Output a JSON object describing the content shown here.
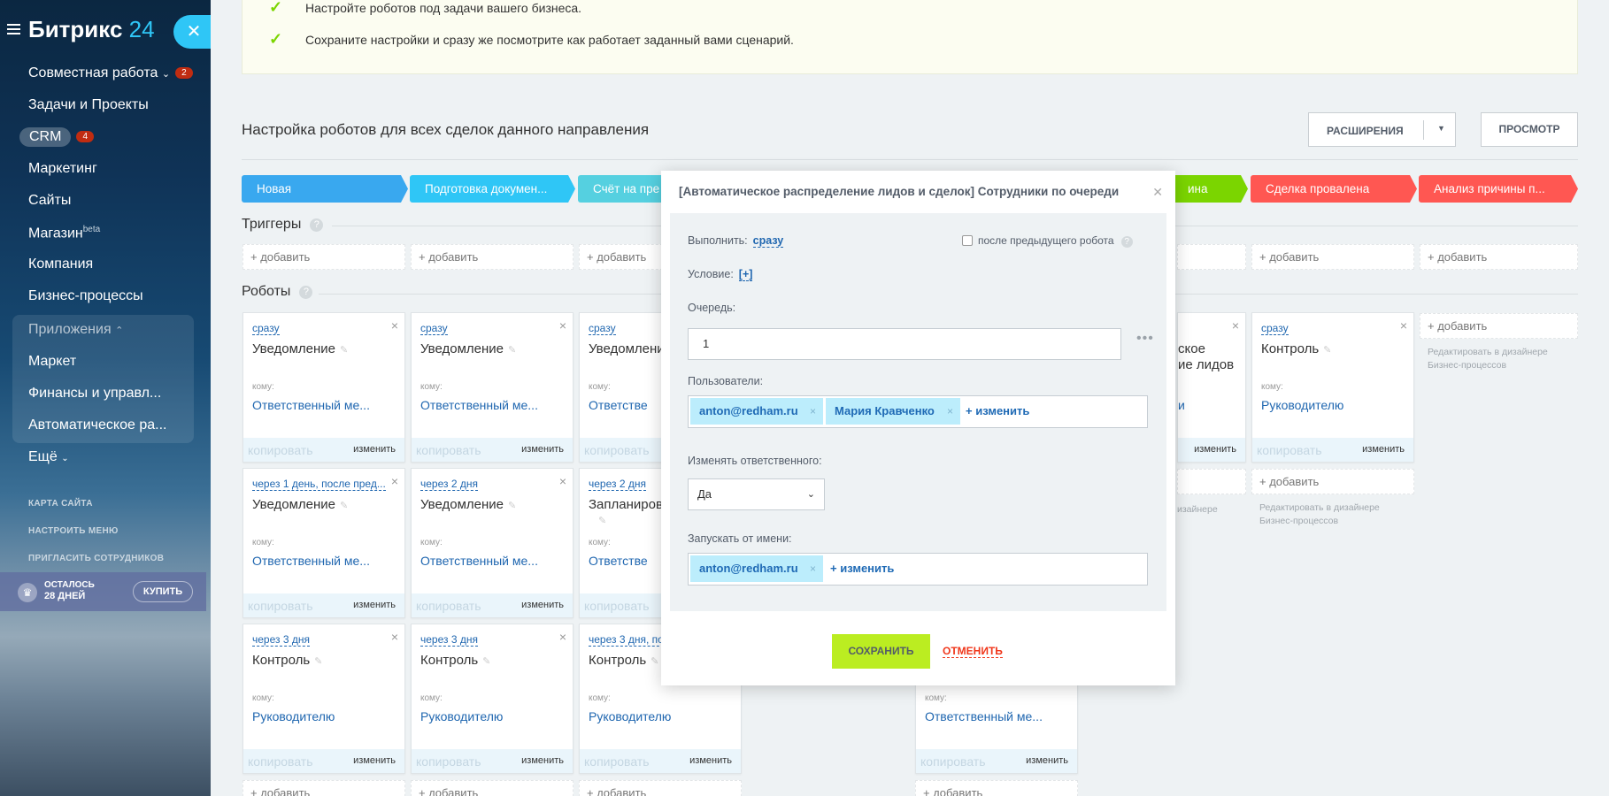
{
  "sidebar": {
    "logo_text": "Битрикс",
    "logo_num": "24",
    "menu": [
      {
        "label": "Совместная работа",
        "badge": "2"
      },
      {
        "label": "Задачи и Проекты"
      },
      {
        "label": "CRM",
        "badge": "4"
      },
      {
        "label": "Маркетинг"
      },
      {
        "label": "Сайты"
      },
      {
        "label": "Магазин",
        "sup": "beta"
      },
      {
        "label": "Компания"
      },
      {
        "label": "Бизнес-процессы"
      },
      {
        "label": "Приложения"
      },
      {
        "label": "Маркет"
      },
      {
        "label": "Финансы и управл..."
      },
      {
        "label": "Автоматическое ра..."
      },
      {
        "label": "Ещё"
      }
    ],
    "links": [
      "КАРТА САЙТА",
      "НАСТРОИТЬ МЕНЮ",
      "ПРИГЛАСИТЬ СОТРУДНИКОВ"
    ],
    "trial": {
      "line1": "ОСТАЛОСЬ",
      "line2": "28 ДНЕЙ",
      "buy": "КУПИТЬ"
    }
  },
  "info": {
    "line1": "Настройте роботов под задачи вашего бизнеса.",
    "line2": "Сохраните настройки и сразу же посмотрите как работает заданный вами сценарий."
  },
  "header": {
    "title": "Настройка роботов для всех сделок данного направления",
    "extensions_label": "РАСШИРЕНИЯ",
    "preview_label": "ПРОСМОТР"
  },
  "stages": [
    {
      "label": "Новая",
      "color": "#39a8ef"
    },
    {
      "label": "Подготовка докумен...",
      "color": "#2fc6f6"
    },
    {
      "label": "Счёт на пре",
      "color": "#55d0e0"
    },
    {
      "label": "ина",
      "color": "#7bd500"
    },
    {
      "label": "Сделка провалена",
      "color": "#ff5752"
    },
    {
      "label": "Анализ причины п...",
      "color": "#ff5752"
    }
  ],
  "triggers": {
    "label": "Триггеры",
    "add": "+ добавить"
  },
  "robots_label": "Роботы",
  "card_common": {
    "to": "кому:",
    "copy": "копировать",
    "edit": "изменить",
    "close": "×",
    "add": "+ добавить"
  },
  "cards": [
    {
      "when": "сразу",
      "title": "Уведомление",
      "who": "Ответственный ме..."
    },
    {
      "when": "сразу",
      "title": "Уведомление",
      "who": "Ответственный ме..."
    },
    {
      "when": "сразу",
      "title": "Уведомлени",
      "who": "Ответстве"
    },
    {
      "when": "сразу",
      "title": "Контроль",
      "who": "Руководителю"
    },
    {
      "when": "через 1 день, после пред...",
      "title": "Уведомление",
      "who": "Ответственный ме..."
    },
    {
      "when": "через 2 дня",
      "title": "Уведомление",
      "who": "Ответственный ме..."
    },
    {
      "when": "через 2 дня",
      "title": "Запланиров",
      "who": "Ответстве"
    },
    {
      "when": "через 3 дня",
      "title": "Контроль",
      "who": "Руководителю"
    },
    {
      "when": "через 3 дня",
      "title": "Контроль",
      "who": "Руководителю"
    },
    {
      "when": "через 3 дня, по",
      "title": "Контроль",
      "who": "Руководителю"
    }
  ],
  "partial_card_top": {
    "title1": "ское",
    "title2": "ие лидов",
    "who": "и"
  },
  "partial_card_bottom": {
    "who": "Ответственный ме..."
  },
  "hint": {
    "line1": "Редактировать в дизайнере",
    "line2": "Бизнес-процессов",
    "partial": "изайнере"
  },
  "modal": {
    "title": "[Автоматическое распределение лидов и сделок] Сотрудники по очереди",
    "run_label": "Выполнить:",
    "run_value": "сразу",
    "after_prev": "после предыдущего робота",
    "condition_label": "Условие:",
    "condition_value": "[+]",
    "queue_label": "Очередь:",
    "queue_value": "1",
    "users_label": "Пользователи:",
    "users": [
      "anton@redham.ru",
      "Мария Кравченко"
    ],
    "change": "+ изменить",
    "change_resp_label": "Изменять ответственного:",
    "change_resp_value": "Да",
    "run_as_label": "Запускать от имени:",
    "run_as": [
      "anton@redham.ru"
    ],
    "save": "СОХРАНИТЬ",
    "cancel": "ОТМЕНИТЬ"
  }
}
